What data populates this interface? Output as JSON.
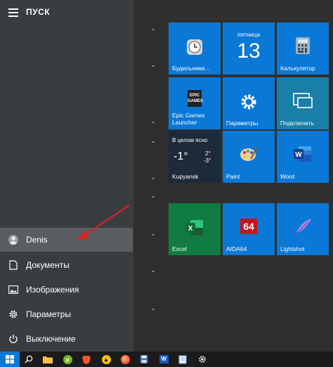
{
  "header": {
    "title": "ПУСК"
  },
  "left_menu": {
    "user": "Denis",
    "items": [
      {
        "label": "Документы",
        "icon": "document-icon"
      },
      {
        "label": "Изображения",
        "icon": "image-icon"
      },
      {
        "label": "Параметры",
        "icon": "gear-icon"
      },
      {
        "label": "Выключение",
        "icon": "power-icon"
      }
    ]
  },
  "tiles": {
    "alarms": "Будильники...",
    "calendar_day": "пятница",
    "calendar_date": "13",
    "calculator": "Калькулятор",
    "epic_logo": "EPIC GAMES",
    "epic": "Epic Games Launcher",
    "settings": "Параметры",
    "connect": "Подключить",
    "weather_status": "В целом ясно",
    "weather_temp": "-1°",
    "weather_hi": "2°",
    "weather_lo": "-3°",
    "weather_city": "Kupyansk",
    "paint": "Paint",
    "word": "Word",
    "excel": "Excel",
    "aida": "AIDA64",
    "aida_logo": "64",
    "lightshot": "Lightshot"
  },
  "colors": {
    "tile_blue": "#0a78d7",
    "sidebar": "#3a3d40",
    "selected": "#5a5d61",
    "annotation_arrow": "#e02020"
  }
}
